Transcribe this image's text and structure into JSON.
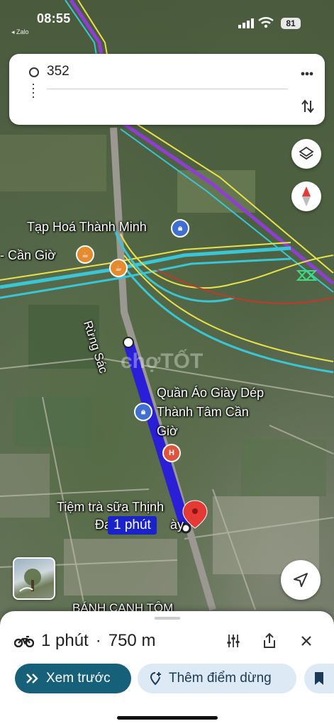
{
  "status_bar": {
    "time": "08:55",
    "carrier": "◂ Zalo",
    "battery": "81"
  },
  "route": {
    "origin": "352"
  },
  "map": {
    "labels": {
      "shop_1": "Tạp Hoá Thành Minh",
      "place_1": "- Cần Giờ",
      "street": "Rừng Sác",
      "shop_2_line1": "Quần Áo Giày Dép",
      "shop_2_line2": "Thành Tâm Cần",
      "shop_2_line3": "Giờ",
      "shop_3": "Tiệm trà sữa Thịnh",
      "shop_3_sub": "Đa",
      "shop_3_sub2": "ày",
      "bottom_label": "BÁNH CANH TÔM"
    },
    "watermark": "chợTỐT",
    "eta_badge": "1 phút",
    "colors": {
      "route": "#2a1fd6",
      "traffic_cyan": "#39c6d6",
      "traffic_yellow": "#e9e24a",
      "traffic_purple": "#8e3fd1",
      "destination_pin": "#e53935"
    }
  },
  "sheet": {
    "mode_icon": "motorbike-icon",
    "duration": "1 phút",
    "separator": "·",
    "distance": "750 m",
    "preview_button": "Xem trước",
    "add_stop_button": "Thêm điểm dừng"
  }
}
